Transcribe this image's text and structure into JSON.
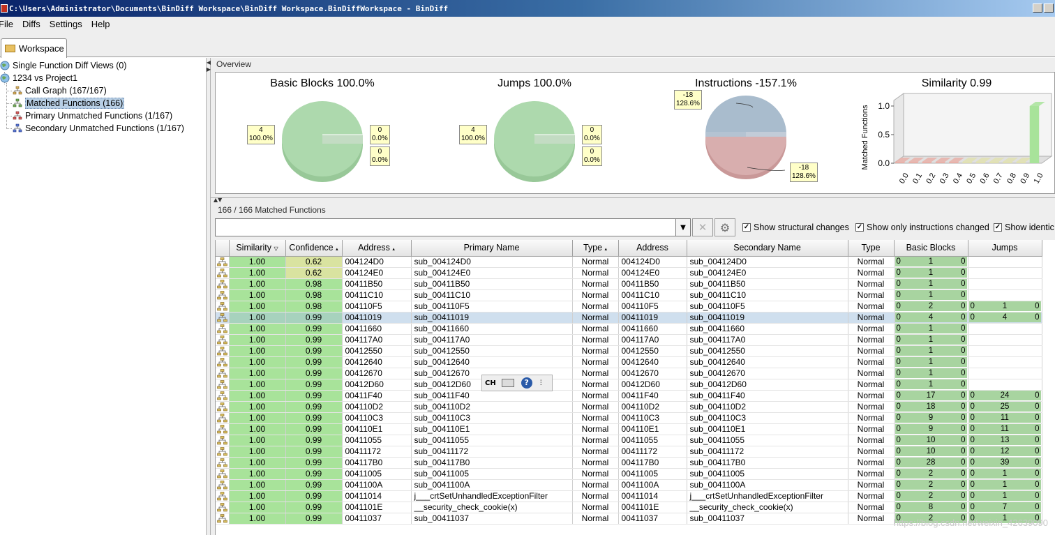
{
  "window": {
    "title": "C:\\Users\\Administrator\\Documents\\BinDiff Workspace\\BinDiff Workspace.BinDiffWorkspace - BinDiff"
  },
  "menu": {
    "items": [
      "File",
      "Diffs",
      "Settings",
      "Help"
    ]
  },
  "tabs": {
    "workspace": "Workspace"
  },
  "tree": {
    "items": [
      {
        "label": "Single Function Diff Views (0)",
        "icon": "globe-icon"
      },
      {
        "label": "1234 vs Project1",
        "icon": "globe-icon"
      },
      {
        "label": "Call Graph (167/167)",
        "icon": "call-graph-icon"
      },
      {
        "label": "Matched Functions (166)",
        "icon": "matched-functions-icon",
        "selected": true
      },
      {
        "label": "Primary Unmatched Functions (1/167)",
        "icon": "primary-unmatched-icon"
      },
      {
        "label": "Secondary Unmatched Functions (1/167)",
        "icon": "secondary-unmatched-icon"
      }
    ]
  },
  "overview": {
    "title": "Overview",
    "charts": [
      {
        "title": "Basic Blocks 100.0%",
        "labels": [
          {
            "top": "4",
            "bottom": "100.0%"
          },
          {
            "top": "0",
            "bottom": "0.0%"
          },
          {
            "top": "0",
            "bottom": "0.0%"
          }
        ]
      },
      {
        "title": "Jumps 100.0%",
        "labels": [
          {
            "top": "4",
            "bottom": "100.0%"
          },
          {
            "top": "0",
            "bottom": "0.0%"
          },
          {
            "top": "0",
            "bottom": "0.0%"
          }
        ]
      },
      {
        "title": "Instructions -157.1%",
        "labels": [
          {
            "top": "-18",
            "bottom": "128.6%"
          },
          {
            "top": "-18",
            "bottom": "128.6%"
          }
        ]
      }
    ],
    "similarity": {
      "title": "Similarity 0.99",
      "ylabel": "Matched Functions",
      "yticks": [
        "1.0",
        "0.5",
        "0.0"
      ],
      "xticks": [
        "0.0",
        "0.1",
        "0.2",
        "0.3",
        "0.4",
        "0.5",
        "0.6",
        "0.7",
        "0.8",
        "0.9",
        "1.0"
      ]
    }
  },
  "chart_data": {
    "type": "bar",
    "title": "Similarity 0.99",
    "ylabel": "Matched Functions",
    "categories": [
      "0.0",
      "0.1",
      "0.2",
      "0.3",
      "0.4",
      "0.5",
      "0.6",
      "0.7",
      "0.8",
      "0.9",
      "1.0"
    ],
    "values": [
      0,
      0,
      0,
      0,
      0,
      0,
      0,
      0,
      0,
      0,
      1.0
    ],
    "ylim": [
      0,
      1.0
    ]
  },
  "matched": {
    "title": "166 / 166 Matched Functions",
    "filter_value": "",
    "options": {
      "structural": "Show structural changes",
      "instructions": "Show only instructions changed",
      "identical": "Show identic"
    },
    "columns": [
      "Similarity",
      "Confidence",
      "Address",
      "Primary Name",
      "Type",
      "Address",
      "Secondary Name",
      "Type",
      "Basic Blocks",
      "Jumps"
    ],
    "rows": [
      {
        "sim": "1.00",
        "conf": "0.62",
        "a1": "004124D0",
        "n1": "sub_004124D0",
        "t1": "Normal",
        "a2": "004124D0",
        "n2": "sub_004124D0",
        "t2": "Normal",
        "bb": [
          "0",
          "1",
          "0"
        ],
        "j": null
      },
      {
        "sim": "1.00",
        "conf": "0.62",
        "a1": "004124E0",
        "n1": "sub_004124E0",
        "t1": "Normal",
        "a2": "004124E0",
        "n2": "sub_004124E0",
        "t2": "Normal",
        "bb": [
          "0",
          "1",
          "0"
        ],
        "j": null
      },
      {
        "sim": "1.00",
        "conf": "0.98",
        "a1": "00411B50",
        "n1": "sub_00411B50",
        "t1": "Normal",
        "a2": "00411B50",
        "n2": "sub_00411B50",
        "t2": "Normal",
        "bb": [
          "0",
          "1",
          "0"
        ],
        "j": null
      },
      {
        "sim": "1.00",
        "conf": "0.98",
        "a1": "00411C10",
        "n1": "sub_00411C10",
        "t1": "Normal",
        "a2": "00411C10",
        "n2": "sub_00411C10",
        "t2": "Normal",
        "bb": [
          "0",
          "1",
          "0"
        ],
        "j": null
      },
      {
        "sim": "1.00",
        "conf": "0.98",
        "a1": "004110F5",
        "n1": "sub_004110F5",
        "t1": "Normal",
        "a2": "004110F5",
        "n2": "sub_004110F5",
        "t2": "Normal",
        "bb": [
          "0",
          "2",
          "0"
        ],
        "j": [
          "0",
          "1",
          "0"
        ]
      },
      {
        "sim": "1.00",
        "conf": "0.99",
        "a1": "00411019",
        "n1": "sub_00411019",
        "t1": "Normal",
        "a2": "00411019",
        "n2": "sub_00411019",
        "t2": "Normal",
        "bb": [
          "0",
          "4",
          "0"
        ],
        "j": [
          "0",
          "4",
          "0"
        ],
        "selected": true
      },
      {
        "sim": "1.00",
        "conf": "0.99",
        "a1": "00411660",
        "n1": "sub_00411660",
        "t1": "Normal",
        "a2": "00411660",
        "n2": "sub_00411660",
        "t2": "Normal",
        "bb": [
          "0",
          "1",
          "0"
        ],
        "j": null
      },
      {
        "sim": "1.00",
        "conf": "0.99",
        "a1": "004117A0",
        "n1": "sub_004117A0",
        "t1": "Normal",
        "a2": "004117A0",
        "n2": "sub_004117A0",
        "t2": "Normal",
        "bb": [
          "0",
          "1",
          "0"
        ],
        "j": null
      },
      {
        "sim": "1.00",
        "conf": "0.99",
        "a1": "00412550",
        "n1": "sub_00412550",
        "t1": "Normal",
        "a2": "00412550",
        "n2": "sub_00412550",
        "t2": "Normal",
        "bb": [
          "0",
          "1",
          "0"
        ],
        "j": null
      },
      {
        "sim": "1.00",
        "conf": "0.99",
        "a1": "00412640",
        "n1": "sub_00412640",
        "t1": "Normal",
        "a2": "00412640",
        "n2": "sub_00412640",
        "t2": "Normal",
        "bb": [
          "0",
          "1",
          "0"
        ],
        "j": null
      },
      {
        "sim": "1.00",
        "conf": "0.99",
        "a1": "00412670",
        "n1": "sub_00412670",
        "t1": "Normal",
        "a2": "00412670",
        "n2": "sub_00412670",
        "t2": "Normal",
        "bb": [
          "0",
          "1",
          "0"
        ],
        "j": null
      },
      {
        "sim": "1.00",
        "conf": "0.99",
        "a1": "00412D60",
        "n1": "sub_00412D60",
        "t1": "Normal",
        "a2": "00412D60",
        "n2": "sub_00412D60",
        "t2": "Normal",
        "bb": [
          "0",
          "1",
          "0"
        ],
        "j": null
      },
      {
        "sim": "1.00",
        "conf": "0.99",
        "a1": "00411F40",
        "n1": "sub_00411F40",
        "t1": "Normal",
        "a2": "00411F40",
        "n2": "sub_00411F40",
        "t2": "Normal",
        "bb": [
          "0",
          "17",
          "0"
        ],
        "j": [
          "0",
          "24",
          "0"
        ]
      },
      {
        "sim": "1.00",
        "conf": "0.99",
        "a1": "004110D2",
        "n1": "sub_004110D2",
        "t1": "Normal",
        "a2": "004110D2",
        "n2": "sub_004110D2",
        "t2": "Normal",
        "bb": [
          "0",
          "18",
          "0"
        ],
        "j": [
          "0",
          "25",
          "0"
        ]
      },
      {
        "sim": "1.00",
        "conf": "0.99",
        "a1": "004110C3",
        "n1": "sub_004110C3",
        "t1": "Normal",
        "a2": "004110C3",
        "n2": "sub_004110C3",
        "t2": "Normal",
        "bb": [
          "0",
          "9",
          "0"
        ],
        "j": [
          "0",
          "11",
          "0"
        ]
      },
      {
        "sim": "1.00",
        "conf": "0.99",
        "a1": "004110E1",
        "n1": "sub_004110E1",
        "t1": "Normal",
        "a2": "004110E1",
        "n2": "sub_004110E1",
        "t2": "Normal",
        "bb": [
          "0",
          "9",
          "0"
        ],
        "j": [
          "0",
          "11",
          "0"
        ]
      },
      {
        "sim": "1.00",
        "conf": "0.99",
        "a1": "00411055",
        "n1": "sub_00411055",
        "t1": "Normal",
        "a2": "00411055",
        "n2": "sub_00411055",
        "t2": "Normal",
        "bb": [
          "0",
          "10",
          "0"
        ],
        "j": [
          "0",
          "13",
          "0"
        ]
      },
      {
        "sim": "1.00",
        "conf": "0.99",
        "a1": "00411172",
        "n1": "sub_00411172",
        "t1": "Normal",
        "a2": "00411172",
        "n2": "sub_00411172",
        "t2": "Normal",
        "bb": [
          "0",
          "10",
          "0"
        ],
        "j": [
          "0",
          "12",
          "0"
        ]
      },
      {
        "sim": "1.00",
        "conf": "0.99",
        "a1": "004117B0",
        "n1": "sub_004117B0",
        "t1": "Normal",
        "a2": "004117B0",
        "n2": "sub_004117B0",
        "t2": "Normal",
        "bb": [
          "0",
          "28",
          "0"
        ],
        "j": [
          "0",
          "39",
          "0"
        ]
      },
      {
        "sim": "1.00",
        "conf": "0.99",
        "a1": "00411005",
        "n1": "sub_00411005",
        "t1": "Normal",
        "a2": "00411005",
        "n2": "sub_00411005",
        "t2": "Normal",
        "bb": [
          "0",
          "2",
          "0"
        ],
        "j": [
          "0",
          "1",
          "0"
        ]
      },
      {
        "sim": "1.00",
        "conf": "0.99",
        "a1": "0041100A",
        "n1": "sub_0041100A",
        "t1": "Normal",
        "a2": "0041100A",
        "n2": "sub_0041100A",
        "t2": "Normal",
        "bb": [
          "0",
          "2",
          "0"
        ],
        "j": [
          "0",
          "1",
          "0"
        ]
      },
      {
        "sim": "1.00",
        "conf": "0.99",
        "a1": "00411014",
        "n1": "j___crtSetUnhandledExceptionFilter",
        "t1": "Normal",
        "a2": "00411014",
        "n2": "j___crtSetUnhandledExceptionFilter",
        "t2": "Normal",
        "bb": [
          "0",
          "2",
          "0"
        ],
        "j": [
          "0",
          "1",
          "0"
        ]
      },
      {
        "sim": "1.00",
        "conf": "0.99",
        "a1": "0041101E",
        "n1": "__security_check_cookie(x)",
        "t1": "Normal",
        "a2": "0041101E",
        "n2": "__security_check_cookie(x)",
        "t2": "Normal",
        "bb": [
          "0",
          "8",
          "0"
        ],
        "j": [
          "0",
          "7",
          "0"
        ]
      },
      {
        "sim": "1.00",
        "conf": "0.99",
        "a1": "00411037",
        "n1": "sub_00411037",
        "t1": "Normal",
        "a2": "00411037",
        "n2": "sub_00411037",
        "t2": "Normal",
        "bb": [
          "0",
          "2",
          "0"
        ],
        "j": [
          "0",
          "1",
          "0"
        ]
      }
    ]
  },
  "ime": {
    "label": "CH"
  },
  "watermark": "https://blog.csdn.net/weixin_42639090",
  "colors": {
    "similarity_high": "#a8e39a",
    "confidence_mid": "#d9e3a0",
    "selection": "#b8cfe5"
  }
}
